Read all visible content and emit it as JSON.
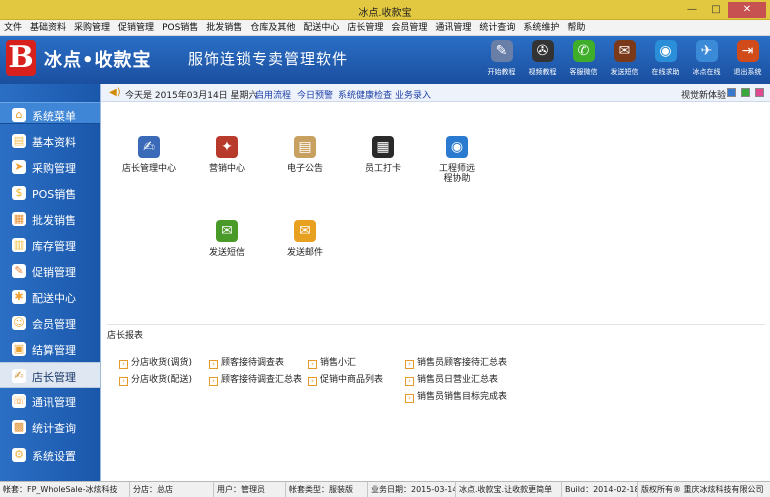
{
  "window": {
    "title": "冰点.收款宝",
    "minimize": "—",
    "maximize": "□",
    "close": "✕"
  },
  "menu": [
    "文件",
    "基础资料",
    "采购管理",
    "促销管理",
    "POS销售",
    "批发销售",
    "仓库及其他",
    "配送中心",
    "店长管理",
    "会员管理",
    "通讯管理",
    "统计查询",
    "系统维护",
    "帮助"
  ],
  "banner": {
    "logo_letter": "B",
    "brand": "冰点•收款宝",
    "slogan": "服饰连锁专卖管理软件",
    "buttons": [
      {
        "label": "开始教程",
        "icon": "✎",
        "color": "#6a7fa8"
      },
      {
        "label": "视频教程",
        "icon": "✇",
        "color": "#333333"
      },
      {
        "label": "客服微信",
        "icon": "✆",
        "color": "#3fae2a"
      },
      {
        "label": "发送短信",
        "icon": "✉",
        "color": "#7a3a1a"
      },
      {
        "label": "在线求助",
        "icon": "◉",
        "color": "#2a8fd8"
      },
      {
        "label": "冰点在线",
        "icon": "✈",
        "color": "#3a8ad8"
      },
      {
        "label": "退出系统",
        "icon": "⇥",
        "color": "#d04a1a"
      }
    ]
  },
  "sidebar": {
    "items": [
      {
        "label": "系统菜单",
        "icon": "⌂",
        "color": "#e8a030"
      },
      {
        "label": "基本资料",
        "icon": "▤",
        "color": "#f0c050"
      },
      {
        "label": "采购管理",
        "icon": "➤",
        "color": "#f0a030"
      },
      {
        "label": "POS销售",
        "icon": "$",
        "color": "#f0b020"
      },
      {
        "label": "批发销售",
        "icon": "▦",
        "color": "#e89030"
      },
      {
        "label": "库存管理",
        "icon": "▥",
        "color": "#f0c040"
      },
      {
        "label": "促销管理",
        "icon": "✎",
        "color": "#e88030"
      },
      {
        "label": "配送中心",
        "icon": "✱",
        "color": "#f0a030"
      },
      {
        "label": "会员管理",
        "icon": "☺",
        "color": "#f0b040"
      },
      {
        "label": "结算管理",
        "icon": "▣",
        "color": "#e8a030"
      },
      {
        "label": "店长管理",
        "icon": "✍",
        "color": "#d09030"
      },
      {
        "label": "通讯管理",
        "icon": "☏",
        "color": "#f0a040"
      },
      {
        "label": "统计查询",
        "icon": "▩",
        "color": "#e09030"
      },
      {
        "label": "系统设置",
        "icon": "⚙",
        "color": "#f0b040"
      }
    ],
    "active": "店长管理"
  },
  "info": {
    "date": "今天是  2015年03月14日  星期六",
    "links": [
      "启用流程",
      "今日预警",
      "系统健康检查",
      "业务录入"
    ],
    "skin_label": "视觉新体验",
    "skin_colors": [
      "#3a78d0",
      "#3aa83a",
      "#e04a90"
    ]
  },
  "functions": [
    {
      "label": "店长管理中心",
      "icon": "✍",
      "color": "#3a6ab8"
    },
    {
      "label": "营销中心",
      "icon": "✦",
      "color": "#b83a2a"
    },
    {
      "label": "电子公告",
      "icon": "▤",
      "color": "#c8a060"
    },
    {
      "label": "员工打卡",
      "icon": "▦",
      "color": "#2a2a2a"
    },
    {
      "label": "工程师远程协助",
      "icon": "◉",
      "color": "#2a7ad0"
    },
    {
      "label": "发送短信",
      "icon": "✉",
      "color": "#4a9a2a"
    },
    {
      "label": "发送邮件",
      "icon": "✉",
      "color": "#e8a020"
    }
  ],
  "reports": {
    "title": "店长报表",
    "links": [
      "分店收货(调货)",
      "分店收货(配送)",
      "顾客接待调查表",
      "顾客接待调查汇总表",
      "销售小汇",
      "促销中商品列表",
      "销售员顾客接待汇总表",
      "销售员日营业汇总表",
      "销售员销售目标完成表"
    ]
  },
  "status": [
    "帐套：FP_WholeSale-冰炫科技",
    "分店：总店",
    "用户：管理员",
    "帐套类型：服装版",
    "业务日期：2015-03-14",
    "冰点.收款宝.让收款更简单",
    "Build：2014-02-18",
    "版权所有® 重庆冰炫科技有限公司"
  ]
}
